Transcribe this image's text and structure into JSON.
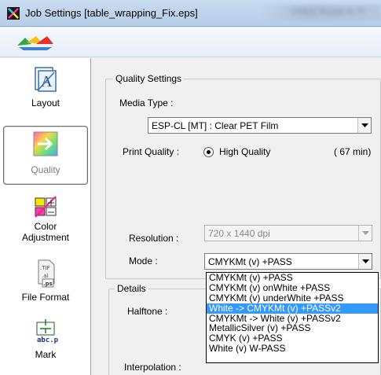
{
  "window": {
    "title": "Job Settings [table_wrapping_Fix.eps]",
    "background_title": "Status: Ready to Pr"
  },
  "nav": {
    "items": [
      {
        "label": "Layout",
        "icon": "layout-icon"
      },
      {
        "label": "Quality",
        "icon": "quality-icon",
        "selected": true
      },
      {
        "label": "Color Adjustment",
        "icon": "color-adjustment-icon"
      },
      {
        "label": "File Format",
        "icon": "file-format-icon"
      },
      {
        "label": "Mark",
        "icon": "mark-icon"
      }
    ]
  },
  "quality_settings": {
    "group_title": "Quality Settings",
    "media_type_label": "Media Type :",
    "media_type_value": "ESP-CL [MT] : Clear PET Film",
    "print_quality_label": "Print Quality :",
    "print_quality_option": "High Quality",
    "print_time": "( 67 min)",
    "resolution_label": "Resolution :",
    "resolution_value": "720 x 1440 dpi",
    "mode_label": "Mode :",
    "mode_value": "CMYKMt (v) +PASS"
  },
  "details": {
    "group_title": "Details",
    "halftone_label": "Halftone :",
    "interpolation_label": "Interpolation :"
  },
  "mode_dropdown": {
    "options": [
      "CMYKMt (v) +PASS",
      "CMYKMt (v) onWhite +PASS",
      "CMYKMt (v) underWhite +PASS",
      "White -> CMYKMt (v) +PASSv2",
      "CMYKMt -> White (v) +PASSv2",
      "MetallicSilver (v) +PASS",
      "CMYK (v) +PASS",
      "White (v) W-PASS"
    ],
    "highlighted_index": 3
  },
  "colors": {
    "highlight": "#3399ff",
    "titlebar": "#c9dbef"
  }
}
